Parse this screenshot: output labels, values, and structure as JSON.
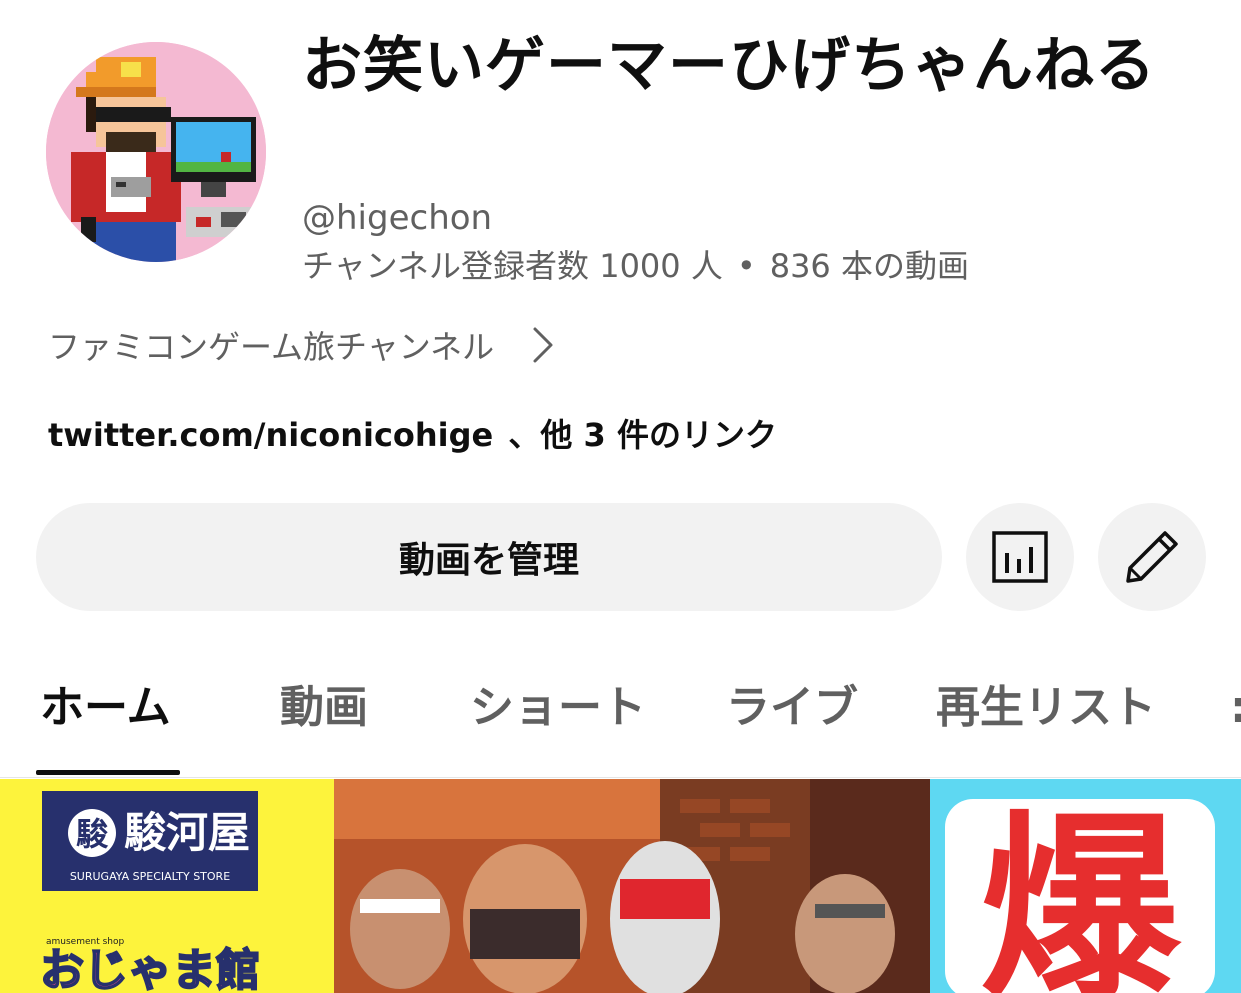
{
  "channel": {
    "name": "お笑いゲーマーひげちゃんねる",
    "handle": "@higechon",
    "subscribers": "チャンネル登録者数 1000 人",
    "separator": "•",
    "video_count": "836 本の動画",
    "description": "ファミコンゲーム旅チャンネル",
    "link_primary": "twitter.com/niconicohige",
    "link_separator": "、",
    "link_more": "他 3 件のリンク"
  },
  "actions": {
    "manage_videos_label": "動画を管理",
    "analytics_icon": "bar-chart-icon",
    "edit_icon": "pencil-icon"
  },
  "tabs": [
    {
      "label": "ホーム",
      "active": true
    },
    {
      "label": "動画",
      "active": false
    },
    {
      "label": "ショート",
      "active": false
    },
    {
      "label": "ライブ",
      "active": false
    },
    {
      "label": "再生リスト",
      "active": false
    }
  ],
  "banner": {
    "shop_logo_text": "駿河屋",
    "shop_subtitle": "SURUGAYA SPECIALTY STORE",
    "shop_small_text": "amusement shop",
    "shop_name": "おじゃま館",
    "right_panel_char": "爆"
  },
  "colors": {
    "text_primary": "#0f0f0f",
    "text_secondary": "#606060",
    "button_bg": "#f2f2f2",
    "avatar_bg": "#f4b9d2",
    "banner_yellow": "#fdf33c",
    "banner_navy": "#27306d",
    "banner_cyan": "#5ed8f2",
    "banner_red": "#e62e2e"
  }
}
